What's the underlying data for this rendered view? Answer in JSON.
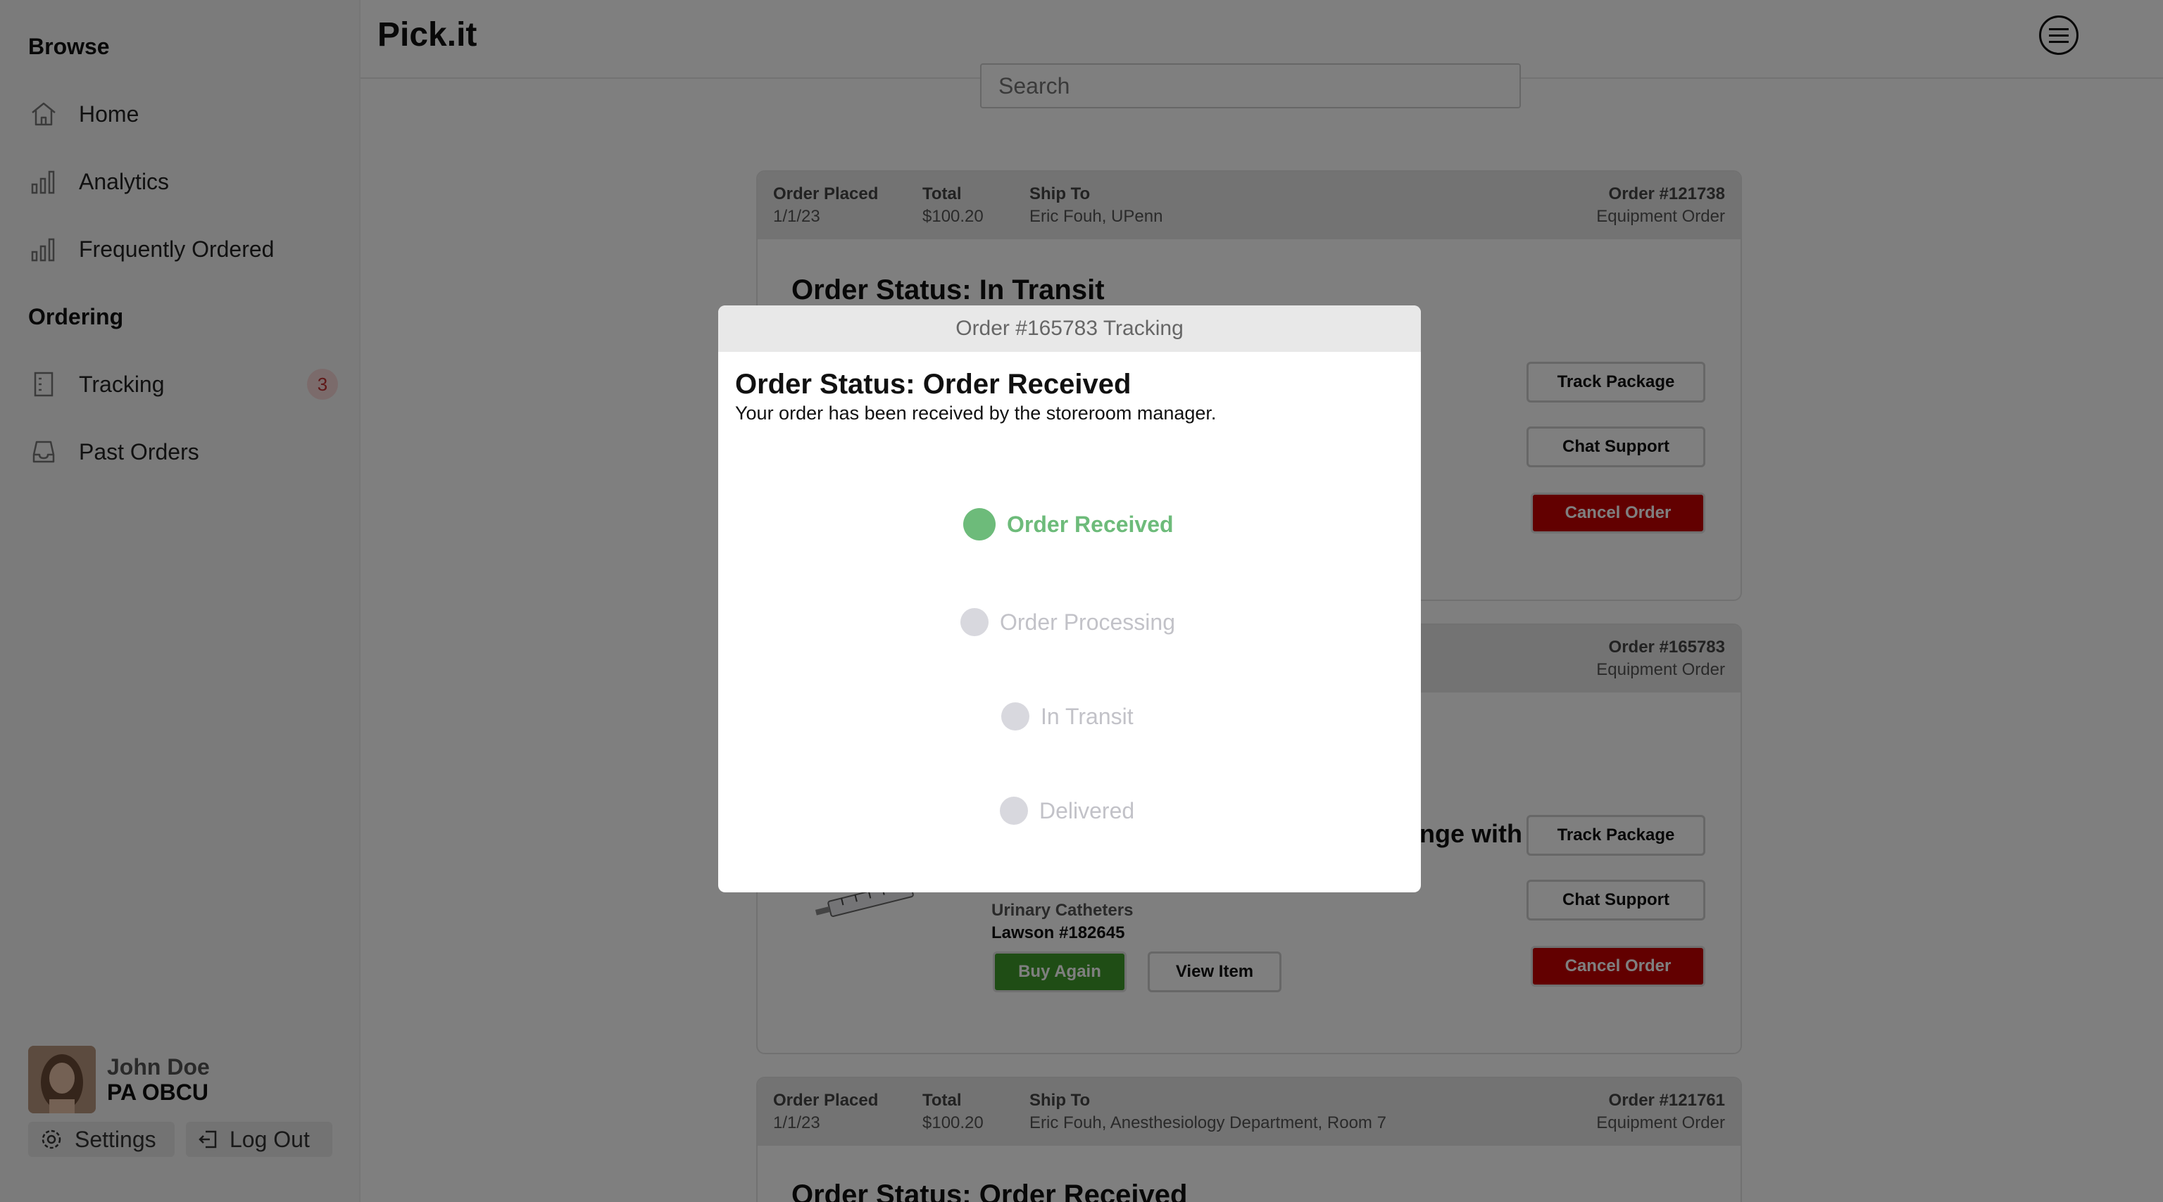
{
  "app": {
    "brand": "Pick.it"
  },
  "sidebar": {
    "browse_heading": "Browse",
    "ordering_heading": "Ordering",
    "browse_items": [
      {
        "label": "Home",
        "icon": "home-icon"
      },
      {
        "label": "Analytics",
        "icon": "bar-chart-icon"
      },
      {
        "label": "Frequently Ordered",
        "icon": "bar-chart-icon"
      }
    ],
    "ordering_items": [
      {
        "label": "Tracking",
        "icon": "tracking-icon",
        "badge": "3"
      },
      {
        "label": "Past Orders",
        "icon": "inbox-icon"
      }
    ],
    "user": {
      "name": "John Doe",
      "role": "PA OBCU"
    },
    "settings_label": "Settings",
    "logout_label": "Log Out"
  },
  "search": {
    "placeholder": "Search"
  },
  "orders": [
    {
      "placed_label": "Order Placed",
      "placed": "1/1/23",
      "total_label": "Total",
      "total": "$100.20",
      "ship_label": "Ship To",
      "ship_to": "Eric Fouh, UPenn",
      "order_number": "Order #121738",
      "order_type": "Equipment Order",
      "status": "Order Status: In Transit",
      "track_label": "Track Package",
      "chat_label": "Chat Support",
      "cancel_label": "Cancel Order"
    },
    {
      "order_number": "Order #165783",
      "order_type": "Equipment Order",
      "item_title_fragment": "nge with",
      "item_category": "Urinary Catheters",
      "item_lawson": "Lawson #182645",
      "buy_again_label": "Buy Again",
      "view_item_label": "View Item",
      "track_label": "Track Package",
      "chat_label": "Chat Support",
      "cancel_label": "Cancel Order"
    },
    {
      "placed_label": "Order Placed",
      "placed": "1/1/23",
      "total_label": "Total",
      "total": "$100.20",
      "ship_label": "Ship To",
      "ship_to": "Eric Fouh, Anesthesiology Department, Room 7",
      "order_number": "Order #121761",
      "order_type": "Equipment Order",
      "status": "Order Status: Order Received"
    }
  ],
  "modal": {
    "header": "Order #165783 Tracking",
    "title": "Order Status: Order Received",
    "description": "Your order has been received by the storeroom manager.",
    "steps": [
      {
        "label": "Order Received",
        "state": "active"
      },
      {
        "label": "Order Processing",
        "state": "inactive"
      },
      {
        "label": "In Transit",
        "state": "inactive"
      },
      {
        "label": "Delivered",
        "state": "inactive"
      }
    ]
  },
  "colors": {
    "active_step": "#6dbb7a",
    "cancel": "#c40000",
    "buy_again": "#3f9a2a",
    "badge_bg": "#f7d6d6",
    "badge_text": "#c03030"
  }
}
